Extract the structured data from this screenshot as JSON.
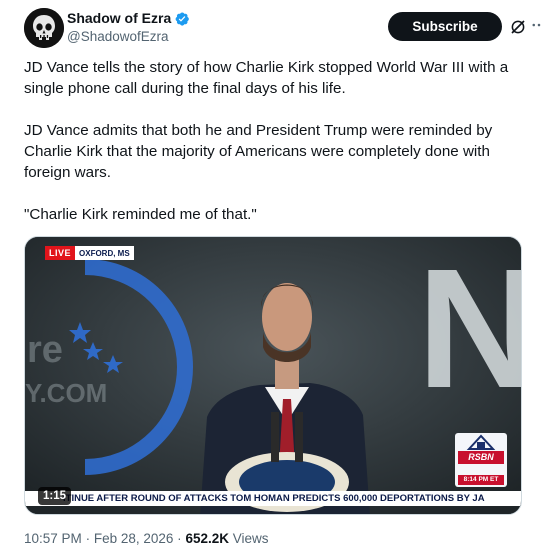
{
  "author": {
    "display_name": "Shadow of Ezra",
    "handle": "@ShadowofEzra",
    "verified": true
  },
  "header": {
    "subscribe_label": "Subscribe",
    "grok_icon": "grok-slash-icon",
    "more_icon": "more-horizontal-icon"
  },
  "tweet": {
    "paragraphs": [
      "JD Vance tells the story of how Charlie Kirk stopped World War III with a single phone call during the final days of his life.",
      "JD Vance admits that both he and President Trump were reminded by Charlie Kirk that the majority of Americans were completely done with foreign wars.",
      "\"Charlie Kirk reminded me of that.\""
    ]
  },
  "media": {
    "live_label": "LIVE",
    "location": "OXFORD, MS",
    "ticker": "ITINUE AFTER ROUND OF ATTACKS   TOM HOMAN PREDICTS 600,000 DEPORTATIONS BY JA",
    "duration": "1:15",
    "network_label": "RSBN",
    "network_time": "8:14 PM ET",
    "backdrop_letters": "N",
    "backdrop_partial_text": "Y.COM"
  },
  "meta": {
    "time": "10:57 PM",
    "separator": "·",
    "date": "Feb 28, 2026",
    "views_count": "652.2K",
    "views_label": "Views"
  },
  "colors": {
    "text_primary": "#0f1419",
    "text_secondary": "#536471",
    "verified_blue": "#1d9bf0",
    "subscribe_bg": "#0f1419"
  }
}
